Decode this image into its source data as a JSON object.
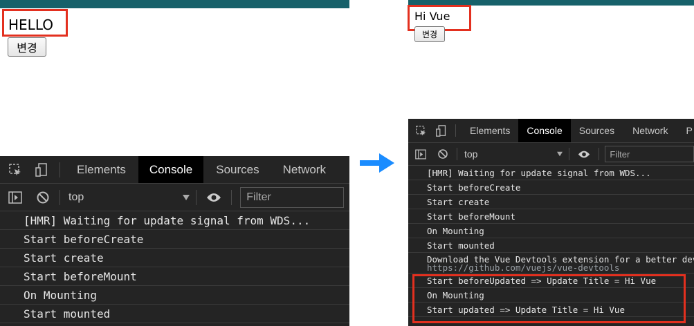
{
  "colors": {
    "topbar": "#17616a",
    "highlight": "#e3301f",
    "arrow": "#1a8cff",
    "console_bg": "#242424"
  },
  "before": {
    "title": "HELLO",
    "button_label": "변경",
    "devtools": {
      "tabs": [
        "Elements",
        "Console",
        "Sources",
        "Network"
      ],
      "active_tab": "Console",
      "context": "top",
      "filter_placeholder": "Filter",
      "icons": [
        "inspect-icon",
        "device-icon",
        "sidebar-toggle-icon",
        "clear-console-icon",
        "dropdown-caret-icon",
        "eye-icon"
      ],
      "lines": [
        "[HMR] Waiting for update signal from WDS...",
        "Start beforeCreate",
        "Start create",
        "Start beforeMount",
        "On Mounting",
        "Start mounted"
      ]
    }
  },
  "arrow_icon": "right-arrow-icon",
  "after": {
    "title": "Hi Vue",
    "button_label": "변경",
    "devtools": {
      "tabs": [
        "Elements",
        "Console",
        "Sources",
        "Network",
        "P"
      ],
      "active_tab": "Console",
      "context": "top",
      "filter_placeholder": "Filter",
      "lines": [
        "[HMR] Waiting for update signal from WDS...",
        "Start beforeCreate",
        "Start create",
        "Start beforeMount",
        "On Mounting",
        "Start mounted",
        "Download the Vue Devtools extension for a better dev",
        "https://github.com/vuejs/vue-devtools",
        "Start beforeUpdated => Update Title = Hi Vue",
        "On Mounting",
        "Start updated => Update Title = Hi Vue"
      ]
    }
  }
}
